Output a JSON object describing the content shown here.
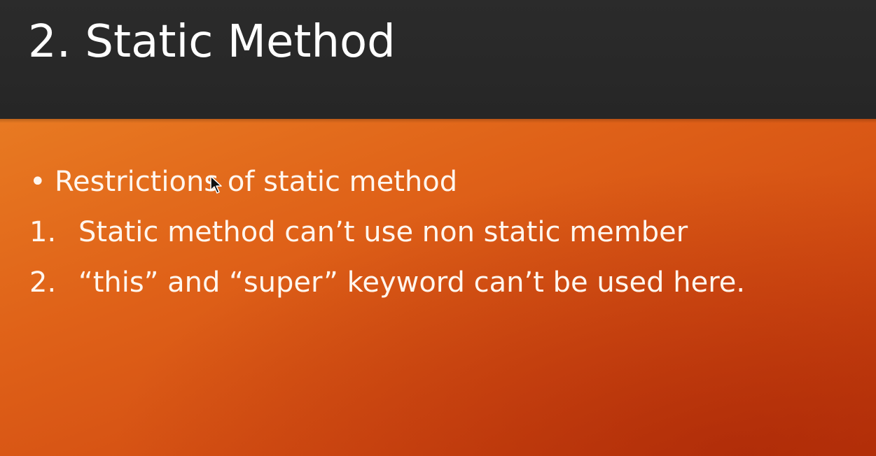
{
  "slide": {
    "title": "2. Static Method",
    "bullet": {
      "marker": "•",
      "text": "Restrictions of static method"
    },
    "items": [
      {
        "marker": "1.",
        "text": "Static method can’t use non static member"
      },
      {
        "marker": "2.",
        "text": "“this” and “super” keyword can’t be used here."
      }
    ]
  },
  "colors": {
    "title_bar": "#272727",
    "body_orange_light": "#e87a22",
    "body_orange_dark": "#c03a0b",
    "text": "#ffffff"
  },
  "icons": {
    "cursor": "mouse-pointer-icon"
  }
}
